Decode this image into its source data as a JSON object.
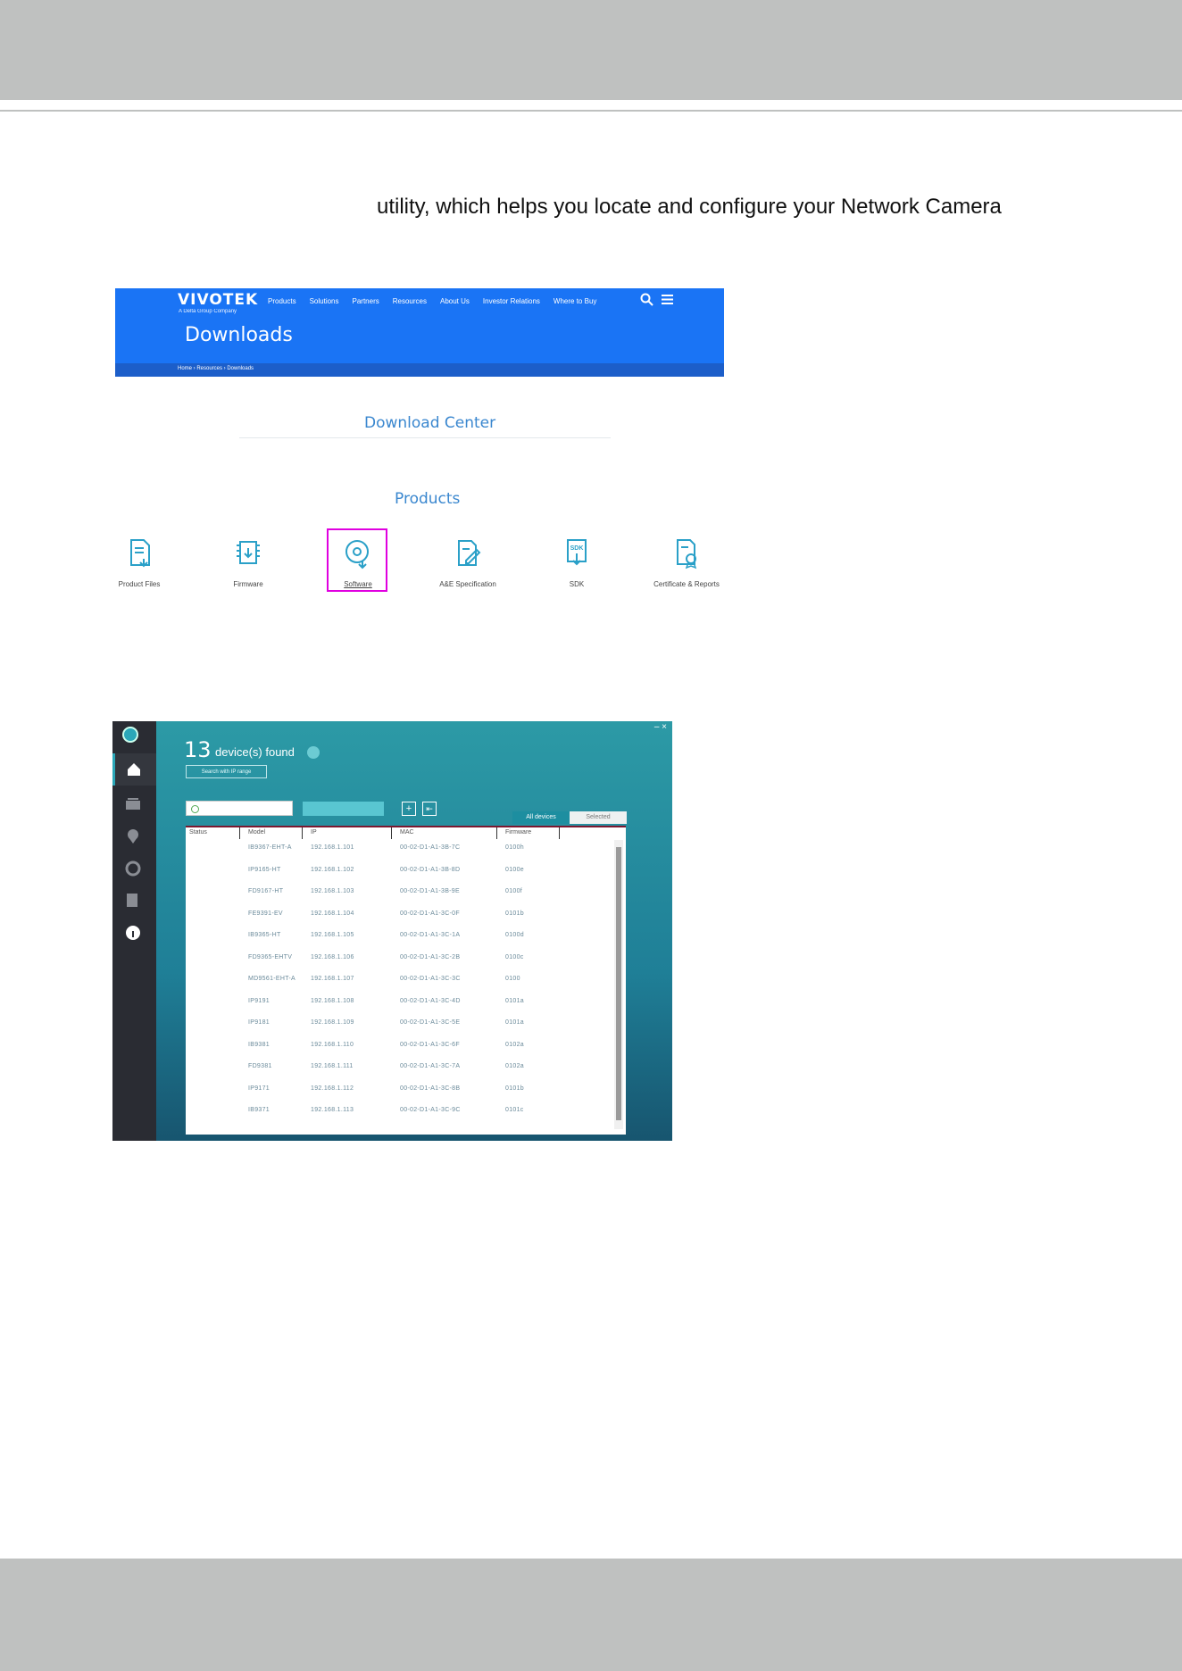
{
  "intro_text": "utility, which helps you locate and configure your Network Camera",
  "website": {
    "logo": "VIVOTEK",
    "logo_sub": "A Delta Group Company",
    "nav": [
      "Products",
      "Solutions",
      "Partners",
      "Resources",
      "About Us",
      "Investor Relations",
      "Where to Buy"
    ],
    "page_title": "Downloads",
    "breadcrumb": "Home › Resources › Downloads",
    "download_center": "Download Center",
    "products_heading": "Products",
    "categories": [
      {
        "label": "Product Files",
        "icon": "document-download-icon"
      },
      {
        "label": "Firmware",
        "icon": "chip-download-icon"
      },
      {
        "label": "Software",
        "icon": "disc-download-icon"
      },
      {
        "label": "A&E Specification",
        "icon": "document-edit-icon"
      },
      {
        "label": "SDK",
        "icon": "sdk-download-icon"
      },
      {
        "label": "Certificate & Reports",
        "icon": "certificate-icon"
      }
    ],
    "highlight_color": "#e000e0",
    "brand_color": "#1a74f5"
  },
  "app": {
    "found_count": "13",
    "found_label": "device(s) found",
    "ip_range_button": "Search with IP range",
    "tab_all": "All devices",
    "tab_selected": "Selected",
    "window_buttons": "– ×",
    "plus_label": "+",
    "export_label": "⇤",
    "columns": [
      "Status",
      "Model",
      "IP",
      "MAC",
      "Firmware"
    ],
    "rows": [
      {
        "model": "IB9367-EHT-A",
        "ip": "192.168.1.101",
        "mac": "00-02-D1-A1-3B-7C",
        "fw": "0100h"
      },
      {
        "model": "IP9165-HT",
        "ip": "192.168.1.102",
        "mac": "00-02-D1-A1-3B-8D",
        "fw": "0100e"
      },
      {
        "model": "FD9167-HT",
        "ip": "192.168.1.103",
        "mac": "00-02-D1-A1-3B-9E",
        "fw": "0100f"
      },
      {
        "model": "FE9391-EV",
        "ip": "192.168.1.104",
        "mac": "00-02-D1-A1-3C-0F",
        "fw": "0101b"
      },
      {
        "model": "IB9365-HT",
        "ip": "192.168.1.105",
        "mac": "00-02-D1-A1-3C-1A",
        "fw": "0100d"
      },
      {
        "model": "FD9365-EHTV",
        "ip": "192.168.1.106",
        "mac": "00-02-D1-A1-3C-2B",
        "fw": "0100c"
      },
      {
        "model": "MD9561-EHT-A",
        "ip": "192.168.1.107",
        "mac": "00-02-D1-A1-3C-3C",
        "fw": "0100"
      },
      {
        "model": "IP9191",
        "ip": "192.168.1.108",
        "mac": "00-02-D1-A1-3C-4D",
        "fw": "0101a"
      },
      {
        "model": "IP9181",
        "ip": "192.168.1.109",
        "mac": "00-02-D1-A1-3C-5E",
        "fw": "0101a"
      },
      {
        "model": "IB9381",
        "ip": "192.168.1.110",
        "mac": "00-02-D1-A1-3C-6F",
        "fw": "0102a"
      },
      {
        "model": "FD9381",
        "ip": "192.168.1.111",
        "mac": "00-02-D1-A1-3C-7A",
        "fw": "0102a"
      },
      {
        "model": "IP9171",
        "ip": "192.168.1.112",
        "mac": "00-02-D1-A1-3C-8B",
        "fw": "0101b"
      },
      {
        "model": "IB9371",
        "ip": "192.168.1.113",
        "mac": "00-02-D1-A1-3C-9C",
        "fw": "0101c"
      }
    ]
  }
}
